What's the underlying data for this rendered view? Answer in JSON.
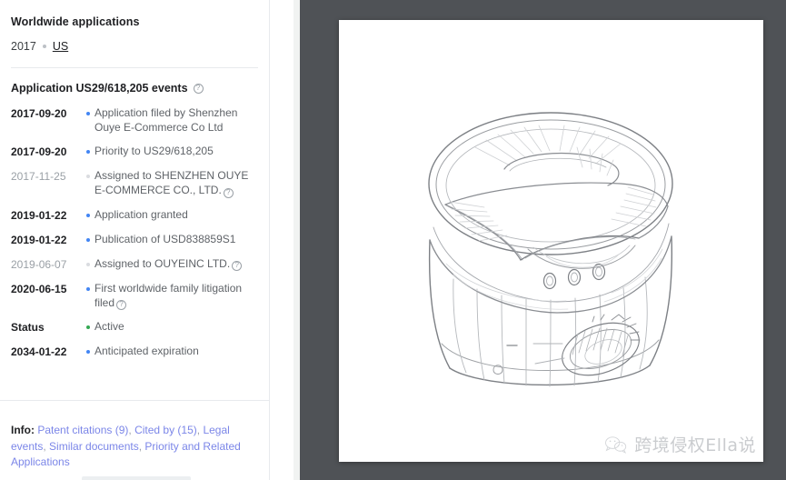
{
  "left_panel": {
    "worldwide_title": "Worldwide applications",
    "worldwide_year": "2017",
    "worldwide_country": "US",
    "events_title": "Application US29/618,205 events",
    "help_glyph": "?",
    "events": [
      {
        "date": "2017-09-20",
        "text": "Application filed by Shenzhen Ouye E-Commerce Co Ltd",
        "style": "normal",
        "help": false
      },
      {
        "date": "2017-09-20",
        "text": "Priority to US29/618,205",
        "style": "normal",
        "help": false
      },
      {
        "date": "2017-11-25",
        "text": "Assigned to SHENZHEN OUYE E-COMMERCE CO., LTD.",
        "style": "muted",
        "help": true
      },
      {
        "date": "2019-01-22",
        "text": "Application granted",
        "style": "normal",
        "help": false
      },
      {
        "date": "2019-01-22",
        "text": "Publication of USD838859S1",
        "style": "normal",
        "help": false
      },
      {
        "date": "2019-06-07",
        "text": "Assigned to OUYEINC LTD.",
        "style": "muted",
        "help": true
      },
      {
        "date": "2020-06-15",
        "text": "First worldwide family litigation filed",
        "style": "normal",
        "help": true
      },
      {
        "date": "Status",
        "text": "Active",
        "style": "status",
        "help": false
      },
      {
        "date": "2034-01-22",
        "text": "Anticipated expiration",
        "style": "normal",
        "help": false
      }
    ],
    "info": {
      "label": "Info:",
      "links": [
        "Patent citations (9)",
        "Cited by (15)",
        "Legal events",
        "Similar documents",
        "Priority and Related Applications"
      ],
      "separator": ", "
    }
  },
  "viewer": {
    "backdrop_color": "#4f5256",
    "page_color": "#ffffff",
    "drawing_name": "patent-figure-cylindrical-diffuser",
    "watermark_text": "跨境侵权Ella说"
  }
}
